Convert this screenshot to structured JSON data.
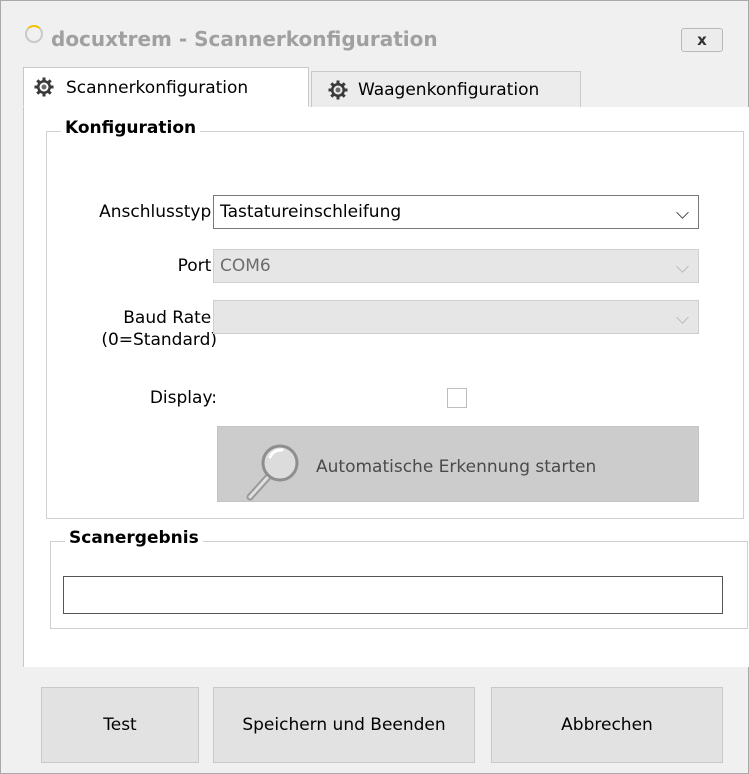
{
  "window": {
    "title": "docuxtrem - Scannerkonfiguration",
    "close_glyph": "x",
    "icon": "app-ring-icon"
  },
  "tabs": [
    {
      "label": "Scannerkonfiguration",
      "icon": "gear-icon",
      "active": true
    },
    {
      "label": "Waagenkonfiguration",
      "icon": "gear-icon",
      "active": false
    }
  ],
  "konfiguration": {
    "title": "Konfiguration",
    "anschlusstyp_label": "Anschlusstyp:",
    "anschlusstyp_value": "Tastatureinschleifung",
    "port_label": "Port:",
    "port_value": "COM6",
    "baud_label_line1": "Baud Rate:",
    "baud_label_line2": "(0=Standard)",
    "baud_value": "",
    "display_label": "Display:",
    "display_checked": false,
    "autodetect_label": "Automatische Erkennung starten",
    "autodetect_icon": "magnifier-icon"
  },
  "scanergebnis": {
    "title": "Scanergebnis",
    "value": ""
  },
  "buttons": {
    "test": "Test",
    "save": "Speichern und Beenden",
    "cancel": "Abbrechen"
  }
}
